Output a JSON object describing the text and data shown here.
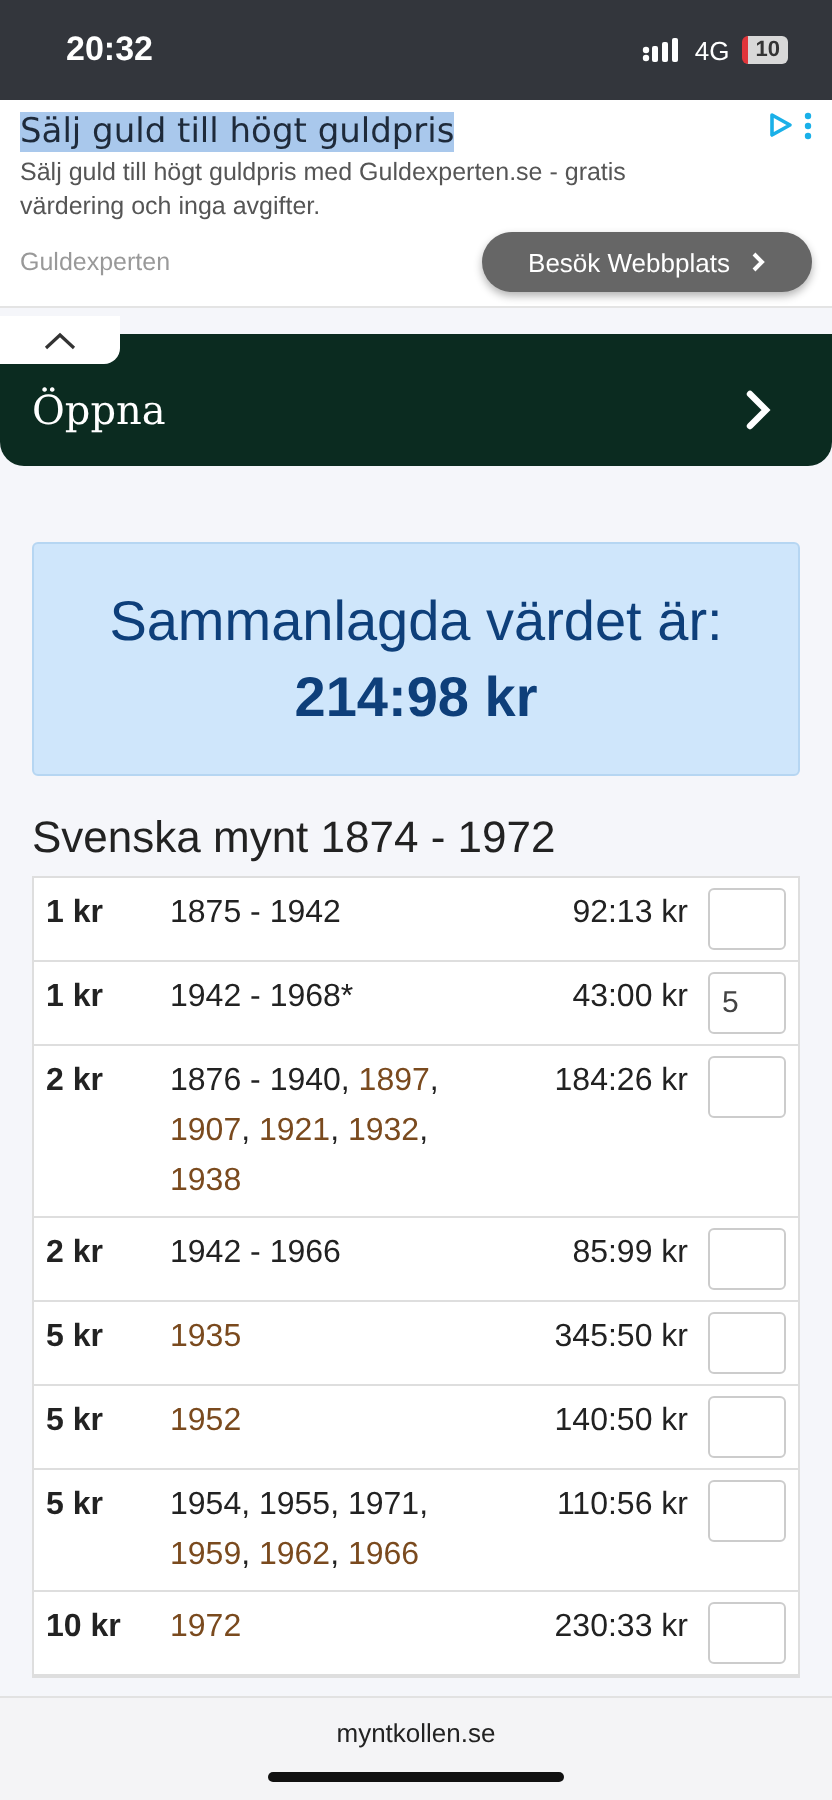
{
  "status_bar": {
    "time": "20:32",
    "network": "4G",
    "battery": "10"
  },
  "ad": {
    "title": "Sälj guld till högt guldpris",
    "title_selected": true,
    "text": "Sälj guld till högt guldpris med Guldexperten.se - gratis värdering och inga avgifter.",
    "advertiser": "Guldexperten",
    "button": "Besök Webbplats"
  },
  "open_bar": {
    "label": "Öppna"
  },
  "total": {
    "label": "Sammanlagda värdet är:",
    "value": "214:98 kr"
  },
  "section_title": "Svenska mynt 1874 - 1972",
  "rows": [
    {
      "denomination": "1 kr",
      "years": [
        {
          "text": "1875 - 1942",
          "rare": false
        }
      ],
      "value": "92:13 kr"
    },
    {
      "denomination": "1 kr",
      "years": [
        {
          "text": "1942 - 1968*",
          "rare": false
        }
      ],
      "value": "43:00 kr",
      "quantity": "5"
    },
    {
      "denomination": "2 kr",
      "years": [
        {
          "text": "1876 - 1940",
          "rare": false,
          "sep": ","
        },
        {
          "text": "1897",
          "rare": true,
          "sep": ","
        },
        {
          "text": "1907",
          "rare": true,
          "sep": ","
        },
        {
          "text": "1921",
          "rare": true,
          "sep": ","
        },
        {
          "text": "1932",
          "rare": true,
          "sep": ","
        },
        {
          "text": "1938",
          "rare": true
        }
      ],
      "value": "184:26 kr"
    },
    {
      "denomination": "2 kr",
      "years": [
        {
          "text": "1942 - 1966",
          "rare": false
        }
      ],
      "value": "85:99 kr"
    },
    {
      "denomination": "5 kr",
      "years": [
        {
          "text": "1935",
          "rare": true
        }
      ],
      "value": "345:50 kr"
    },
    {
      "denomination": "5 kr",
      "years": [
        {
          "text": "1952",
          "rare": true
        }
      ],
      "value": "140:50 kr"
    },
    {
      "denomination": "5 kr",
      "years": [
        {
          "text": "1954",
          "rare": false,
          "sep": ","
        },
        {
          "text": "1955",
          "rare": false,
          "sep": ","
        },
        {
          "text": "1971",
          "rare": false,
          "sep": ","
        },
        {
          "text": "1959",
          "rare": true,
          "sep": ","
        },
        {
          "text": "1962",
          "rare": true,
          "sep": ","
        },
        {
          "text": "1966",
          "rare": true
        }
      ],
      "value": "110:56 kr"
    },
    {
      "denomination": "10 kr",
      "years": [
        {
          "text": "1972",
          "rare": true
        }
      ],
      "value": "230:33 kr"
    }
  ],
  "footer": {
    "domain": "myntkollen.se"
  }
}
